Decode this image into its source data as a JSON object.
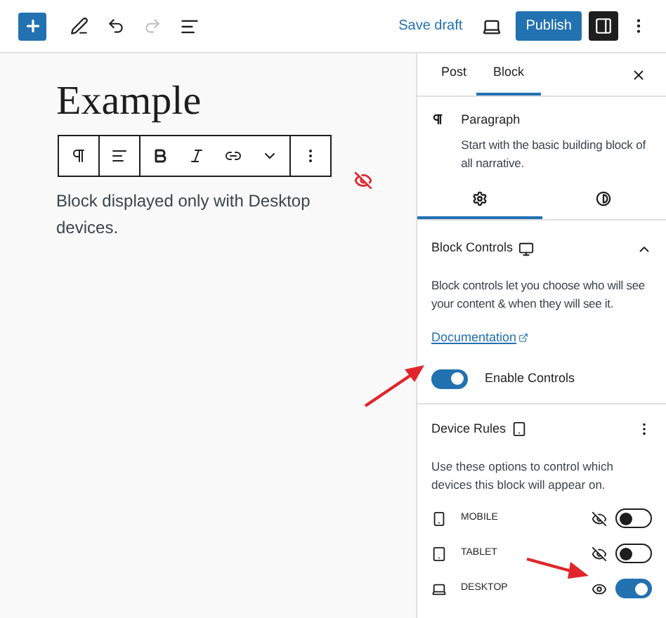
{
  "topbar": {
    "save_draft": "Save draft",
    "publish": "Publish"
  },
  "editor": {
    "heading": "Example",
    "paragraph": "Block displayed only with Desktop devices.",
    "hidden_on_current_device": true
  },
  "block_toolbar": [
    {
      "kind": "paragraph"
    },
    {
      "kind": "align"
    },
    {
      "kind": "bold"
    },
    {
      "kind": "italic"
    },
    {
      "kind": "link"
    },
    {
      "kind": "more"
    },
    {
      "kind": "options"
    }
  ],
  "sidebar": {
    "tabs": [
      {
        "label": "Post",
        "selected": false
      },
      {
        "label": "Block",
        "selected": true
      }
    ],
    "block": {
      "name": "Paragraph",
      "description": "Start with the basic building block of all narrative."
    },
    "settings_tabs": [
      {
        "kind": "settings",
        "selected": true
      },
      {
        "kind": "styles",
        "selected": false
      }
    ],
    "block_controls": {
      "title": "Block Controls",
      "expanded": true,
      "description": "Block controls let you choose who will see your content & when they will see it.",
      "link": "Documentation",
      "toggle": {
        "label": "Enable Controls",
        "on": true
      }
    },
    "device_rules": {
      "title": "Device Rules",
      "description": "Use these options to control which devices this block will appear on.",
      "devices": [
        {
          "kind": "mobile",
          "label": "MOBILE",
          "visible": false,
          "on": false
        },
        {
          "kind": "tablet",
          "label": "TABLET",
          "visible": false,
          "on": false
        },
        {
          "kind": "desktop",
          "label": "DESKTOP",
          "visible": true,
          "on": true
        }
      ]
    }
  }
}
